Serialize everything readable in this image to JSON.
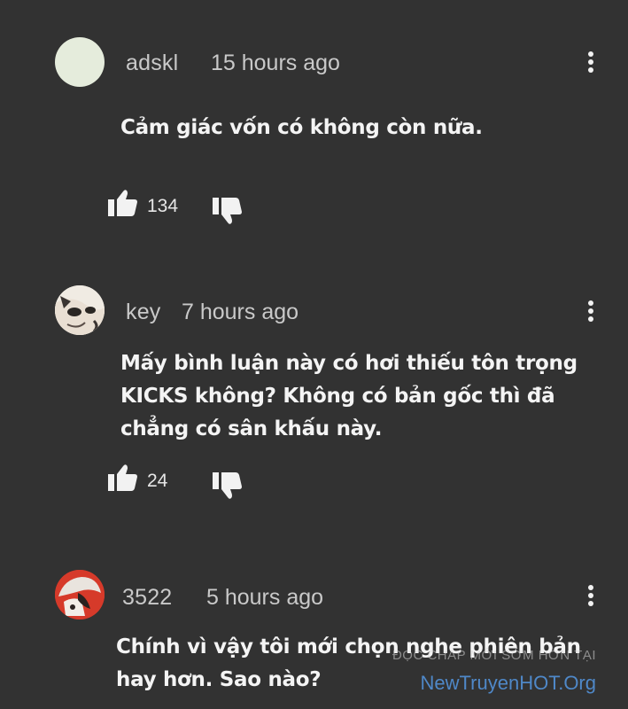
{
  "comments": [
    {
      "username": "adskl",
      "time": "15 hours ago",
      "lines": [
        "Cảm giác vốn có không còn nữa."
      ],
      "likes": "134",
      "avatar_color": "#e5ecdc"
    },
    {
      "username": "key",
      "time": "7 hours ago",
      "lines": [
        "Mấy bình luận này có hơi thiếu tôn trọng",
        "KICKS không? Không có bản gốc thì đã",
        "chẳng có sân khấu này."
      ],
      "likes": "24"
    },
    {
      "username": "3522",
      "time": "5 hours ago",
      "lines": [
        "Chính vì vậy tôi mới chọn nghe phiên bản",
        "hay hơn. Sao nào?"
      ],
      "avatar_color": "#d63a2a"
    }
  ],
  "icons": {
    "like": "thumbs-up-icon",
    "dislike": "thumbs-down-icon",
    "menu": "more-vertical-icon"
  },
  "watermark": {
    "line1": "ĐỌC CHAP MỚI SỚM HƠN TẠI",
    "line2": "NewTruyenHOT.Org",
    "link_color": "#4f88c8"
  },
  "colors": {
    "background": "#323232",
    "text": "#f4f4f4",
    "meta": "#c9c9c9"
  }
}
